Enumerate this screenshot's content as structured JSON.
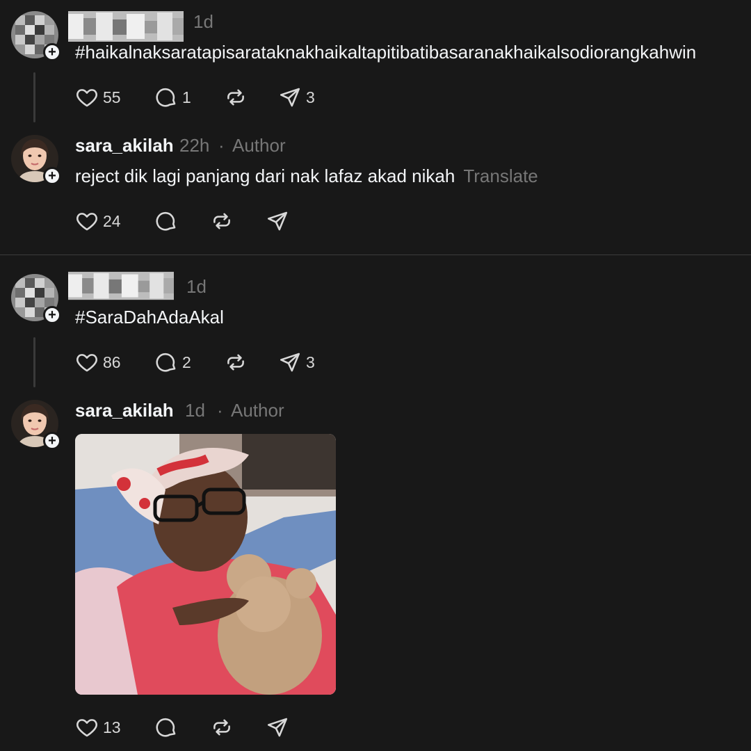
{
  "threads": [
    {
      "post": {
        "time": "1d",
        "text": "#haikalnaksaratapisarataknakhaikaltapitibatibasaranakhaikalsodiorangkahwin",
        "likes": "55",
        "replies": "1",
        "shares": "3"
      },
      "reply": {
        "username": "sara_akilah",
        "time": "22h",
        "separator": "·",
        "badge": "Author",
        "text": "reject dik lagi panjang dari nak lafaz akad nikah",
        "translate": "Translate",
        "likes": "24"
      }
    },
    {
      "post": {
        "time": "1d",
        "text": "#SaraDahAdaAkal",
        "likes": "86",
        "replies": "2",
        "shares": "3"
      },
      "reply": {
        "username": "sara_akilah",
        "time": "1d",
        "separator": "·",
        "badge": "Author",
        "likes": "13"
      }
    }
  ],
  "icons": {
    "like": "heart-icon",
    "reply": "comment-icon",
    "repost": "repost-icon",
    "share": "send-icon",
    "follow": "plus-icon"
  },
  "colors": {
    "background": "#181818",
    "text": "#f3f5f7",
    "muted": "#777777",
    "divider": "#3c3c3c"
  }
}
